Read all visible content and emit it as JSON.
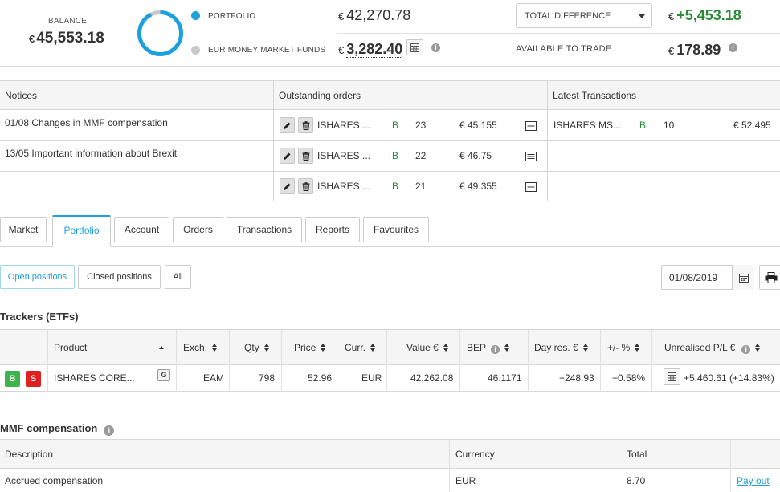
{
  "summary": {
    "balance_label": "BALANCE",
    "currency_symbol": "€",
    "balance_value": "45,553.18",
    "portfolio_label": "PORTFOLIO",
    "portfolio_value": "42,270.78",
    "mmf_label": "EUR MONEY MARKET FUNDS",
    "mmf_value": "3,282.40",
    "difference_select": "TOTAL DIFFERENCE",
    "difference_value": "+5,453.18",
    "available_label": "AVAILABLE TO TRADE",
    "available_value": "178.89",
    "donut_colors": [
      "#1ca1dc",
      "#c8c8c8"
    ]
  },
  "notices": {
    "header": "Notices",
    "items": [
      "01/08 Changes in MMF compensation",
      "13/05 Important information about Brexit"
    ]
  },
  "orders": {
    "header": "Outstanding orders",
    "rows": [
      {
        "product": "ISHARES ...",
        "side": "B",
        "qty": "23",
        "price": "€ 45.155"
      },
      {
        "product": "ISHARES ...",
        "side": "B",
        "qty": "22",
        "price": "€ 46.75"
      },
      {
        "product": "ISHARES ...",
        "side": "B",
        "qty": "21",
        "price": "€ 49.355"
      }
    ]
  },
  "transactions": {
    "header": "Latest Transactions",
    "rows": [
      {
        "product": "ISHARES MS...",
        "side": "B",
        "qty": "10",
        "price": "€ 52.495"
      }
    ]
  },
  "tabs": [
    "Market",
    "Portfolio",
    "Account",
    "Orders",
    "Transactions",
    "Reports",
    "Favourites"
  ],
  "subtabs": [
    "Open positions",
    "Closed positions",
    "All"
  ],
  "date_value": "01/08/2019",
  "trackers": {
    "title": "Trackers (ETFs)",
    "columns": {
      "product": "Product",
      "exch": "Exch.",
      "qty": "Qty",
      "price": "Price",
      "curr": "Curr.",
      "value": "Value €",
      "bep": "BEP",
      "dayres": "Day res. €",
      "pct": "+/- %",
      "pl": "Unrealised P/L €"
    },
    "row": {
      "buy": "B",
      "sell": "S",
      "product": "ISHARES CORE...",
      "badge": "G",
      "exch": "EAM",
      "qty": "798",
      "price": "52.96",
      "curr": "EUR",
      "value": "42,262.08",
      "bep": "46.1171",
      "dayres": "+248.93",
      "pct": "+0.58%",
      "pl": "+5,460.61 (+14.83%)"
    }
  },
  "mmf": {
    "title": "MMF compensation",
    "columns": {
      "description": "Description",
      "currency": "Currency",
      "total": "Total"
    },
    "row": {
      "description": "Accrued compensation",
      "currency": "EUR",
      "total": "8.70",
      "action": "Pay out"
    }
  },
  "colors": {
    "accent": "#1ca1dc",
    "positive": "#2a8a3a",
    "buy": "#3cb54a",
    "sell": "#e02020"
  }
}
